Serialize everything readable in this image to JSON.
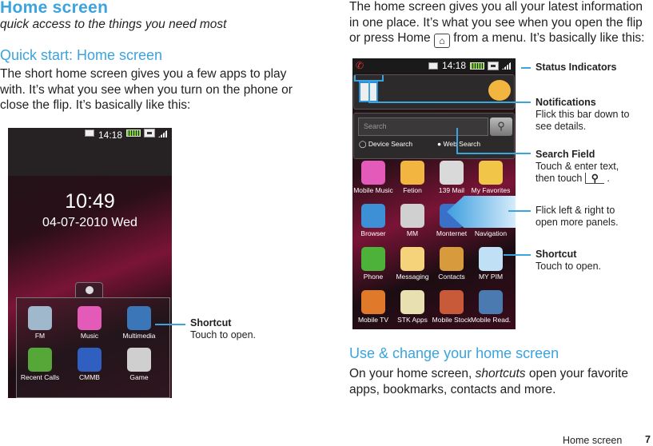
{
  "left": {
    "title": "Home screen",
    "subtitle": "quick access to the things you need most",
    "section": "Quick start: Home screen",
    "body": "The short home screen gives you a few apps to play with. It’s what you see when you turn on the phone or close the flip. It’s basically like this:",
    "phone": {
      "status_time": "14:18",
      "clock": "10:49",
      "date": "04-07-2010 Wed",
      "apps": [
        {
          "label": "FM",
          "color": "#9fb8cc"
        },
        {
          "label": "Music",
          "color": "#e35ab8"
        },
        {
          "label": "Multimedia",
          "color": "#3a76b8"
        },
        {
          "label": "Recent Calls",
          "color": "#55a838"
        },
        {
          "label": "CMMB",
          "color": "#2f5fc0"
        },
        {
          "label": "Game",
          "color": "#cfcfcf"
        }
      ]
    },
    "callout": {
      "title": "Shortcut",
      "text": "Touch to open."
    }
  },
  "right": {
    "body_1": "The home screen gives you all your latest information in one place. It’s what you see when you open the flip or press Home",
    "body_2": "from a menu. It’s basically like this:",
    "phone": {
      "status_time": "14:18",
      "search_placeholder": "Search",
      "device_search": "Device Search",
      "web_search": "Web Search",
      "apps": [
        {
          "label": "Mobile Music",
          "color": "#e35ab8"
        },
        {
          "label": "Fetion",
          "color": "#f2b640"
        },
        {
          "label": "139 Mail",
          "color": "#d9d9d9"
        },
        {
          "label": "My Favorites",
          "color": "#f1c547"
        },
        {
          "label": "Browser",
          "color": "#3d8fd6"
        },
        {
          "label": "MM",
          "color": "#d0d0d0"
        },
        {
          "label": "Monternet",
          "color": "#3a70c8"
        },
        {
          "label": "Navigation",
          "color": "#6aa6e0"
        },
        {
          "label": "Phone",
          "color": "#4cb23a"
        },
        {
          "label": "Messaging",
          "color": "#f4d37a"
        },
        {
          "label": "Contacts",
          "color": "#d79a3c"
        },
        {
          "label": "MY PIM",
          "color": "#bfe0f5"
        },
        {
          "label": "Mobile TV",
          "color": "#e07a2a"
        },
        {
          "label": "STK Apps",
          "color": "#e8e0b0"
        },
        {
          "label": "Mobile Stock",
          "color": "#c85a3a"
        },
        {
          "label": "Mobile Read.",
          "color": "#4a7ab0"
        }
      ]
    },
    "callouts": [
      {
        "title": "Status Indicators",
        "text": ""
      },
      {
        "title": "Notifications",
        "text": "Flick this bar down to see details."
      },
      {
        "title": "Search Field",
        "text": "Touch & enter text, then touch",
        "text_end": "."
      },
      {
        "title": "",
        "text": "Flick left & right to open more panels."
      },
      {
        "title": "Shortcut",
        "text": "Touch to open."
      }
    ],
    "section": "Use & change your home screen",
    "body_3a": "On your home screen,",
    "body_3b": "shortcuts",
    "body_3c": "open your favorite apps, bookmarks, contacts and more."
  },
  "footer": {
    "section": "Home screen",
    "page": "7"
  },
  "colors": {
    "accent": "#3ba3dd"
  }
}
